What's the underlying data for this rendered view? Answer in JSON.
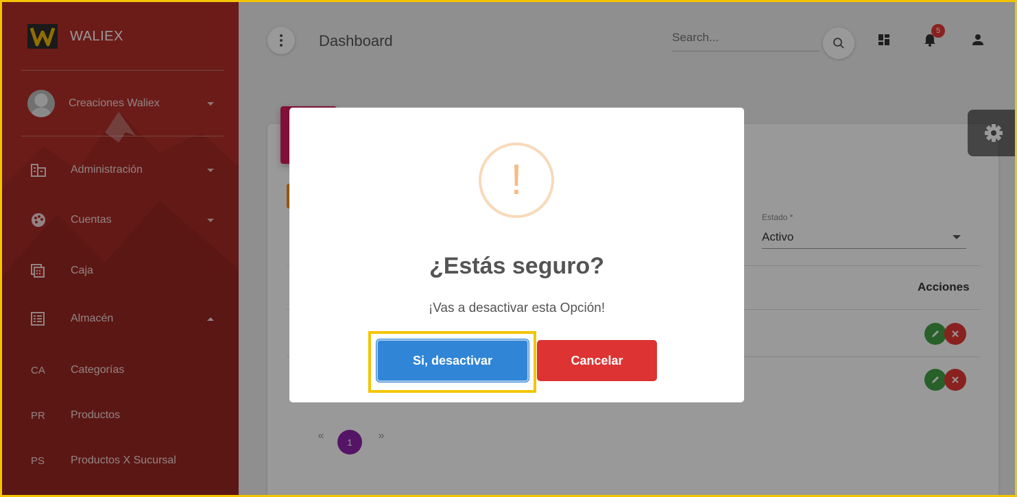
{
  "sidebar": {
    "brand": "WALIEX",
    "user_name": "Creaciones Waliex",
    "items": [
      {
        "label": "Administración",
        "icon": "building-icon"
      },
      {
        "label": "Cuentas",
        "icon": "palette-icon"
      },
      {
        "label": "Caja",
        "icon": "cash-register-icon"
      },
      {
        "label": "Almacén",
        "icon": "list-box-icon"
      },
      {
        "abbr": "CA",
        "label": "Categorías"
      },
      {
        "abbr": "PR",
        "label": "Productos"
      },
      {
        "abbr": "PS",
        "label": "Productos X Sucursal"
      }
    ]
  },
  "topbar": {
    "title": "Dashboard",
    "search_placeholder": "Search...",
    "notification_count": "5"
  },
  "filter": {
    "estado_label": "Estado *",
    "estado_value": "Activo"
  },
  "table": {
    "actions_header": "Acciones"
  },
  "pagination": {
    "prev": "«",
    "current": "1",
    "next": "»"
  },
  "modal": {
    "icon_glyph": "!",
    "title": "¿Estás seguro?",
    "text": "¡Vas a desactivar esta Opción!",
    "confirm_label": "Si, desactivar",
    "cancel_label": "Cancelar"
  },
  "colors": {
    "sidebar": "#b3302a",
    "confirm": "#3085d6",
    "cancel": "#dd3333",
    "warning": "#f8bb86",
    "pager_active": "#8e24aa",
    "focus_highlight": "#f5c400"
  }
}
